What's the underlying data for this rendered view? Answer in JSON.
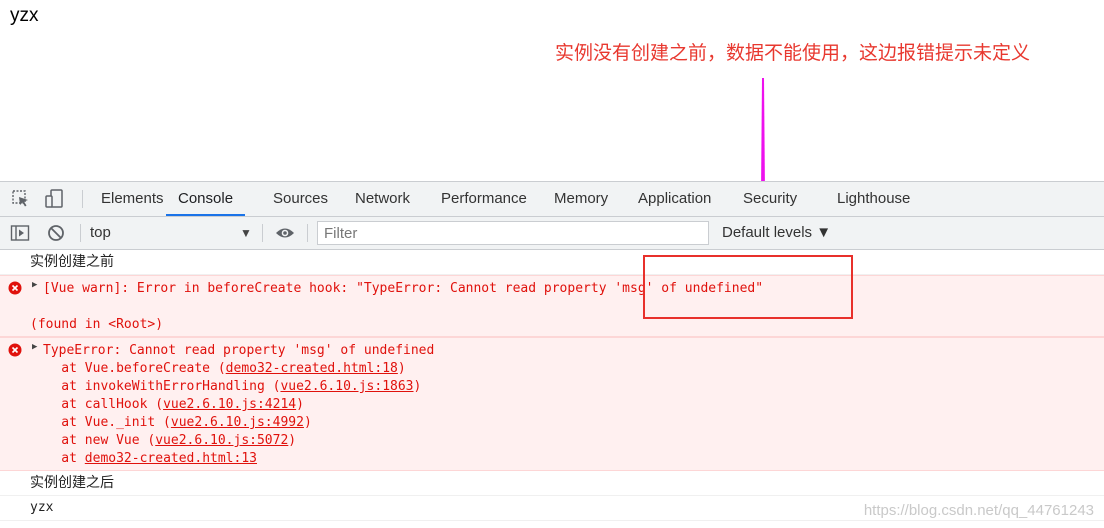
{
  "page": {
    "text": "yzx"
  },
  "annotation": {
    "text": "实例没有创建之前，数据不能使用，这边报错提示未定义"
  },
  "devtools": {
    "tabs": [
      "Elements",
      "Console",
      "Sources",
      "Network",
      "Performance",
      "Memory",
      "Application",
      "Security",
      "Lighthouse"
    ],
    "active_tab": "Console",
    "toolbar": {
      "context": "top",
      "filter_placeholder": "Filter",
      "levels": "Default levels ▼"
    },
    "messages": {
      "log1": "实例创建之前",
      "error1": {
        "line1": "[Vue warn]: Error in beforeCreate hook: \"TypeError: Cannot read property 'msg' of undefined\"",
        "line2": "(found in <Root>)"
      },
      "error2": {
        "head": "TypeError: Cannot read property 'msg' of undefined",
        "stack": [
          {
            "prefix": "    at Vue.beforeCreate (",
            "link": "demo32-created.html:18",
            "suffix": ")"
          },
          {
            "prefix": "    at invokeWithErrorHandling (",
            "link": "vue2.6.10.js:1863",
            "suffix": ")"
          },
          {
            "prefix": "    at callHook (",
            "link": "vue2.6.10.js:4214",
            "suffix": ")"
          },
          {
            "prefix": "    at Vue._init (",
            "link": "vue2.6.10.js:4992",
            "suffix": ")"
          },
          {
            "prefix": "    at new Vue (",
            "link": "vue2.6.10.js:5072",
            "suffix": ")"
          },
          {
            "prefix": "    at ",
            "link": "demo32-created.html:13",
            "suffix": ""
          }
        ]
      },
      "log2": "实例创建之后",
      "log3": "yzx"
    }
  },
  "watermark": "https://blog.csdn.net/qq_44761243",
  "colors": {
    "annotation": "#e8382f",
    "arrow": "#ee11ee",
    "error_text": "#e0110c",
    "error_bg": "#fff0f0",
    "active_tab": "#1a73e8"
  }
}
